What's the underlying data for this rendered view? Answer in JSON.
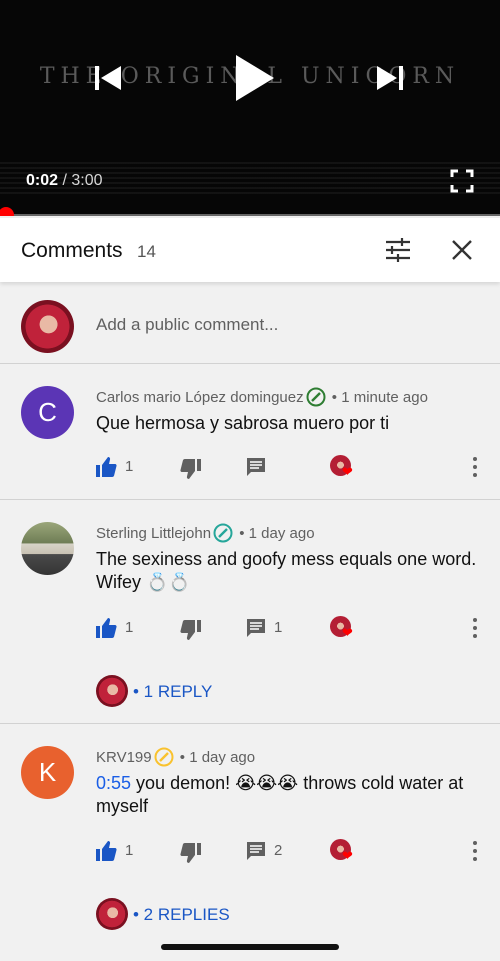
{
  "player": {
    "video_title": "THE ORIGINAL UNICORN",
    "current_time": "0:02",
    "separator": " / ",
    "duration": "3:00",
    "progress_fraction": 0.011,
    "progress_color": "#ff0000"
  },
  "comments_header": {
    "title": "Comments",
    "count": "14",
    "sort_icon": "sort-filter-icon",
    "close_icon": "close-icon"
  },
  "add_comment": {
    "placeholder": "Add a public comment..."
  },
  "comments": [
    {
      "author": "Carlos mario López dominguez",
      "time": "1 minute ago",
      "avatar_letter": "C",
      "avatar_color": "#5b35b5",
      "badge_color": "#2e7d32",
      "text": "Que hermosa y sabrosa muero por ti",
      "likes": "1",
      "replies_count": ""
    },
    {
      "author": "Sterling Littlejohn",
      "time": "1 day ago",
      "avatar_letter": "",
      "badge_color": "#26a69a",
      "text": "The sexiness and goofy mess equals one word. Wifey 💍💍",
      "likes": "1",
      "replies_count": "1",
      "view_replies": "• 1 REPLY"
    },
    {
      "author": "KRV199",
      "time": "1 day ago",
      "avatar_letter": "K",
      "avatar_color": "#e8612e",
      "badge_color": "#f9c22e",
      "timestamp_link": "0:55",
      "text": " you demon! 😭😭😭 throws cold water at myself",
      "likes": "1",
      "replies_count": "2",
      "view_replies": "• 2 REPLIES"
    }
  ],
  "meta_separator": " • "
}
